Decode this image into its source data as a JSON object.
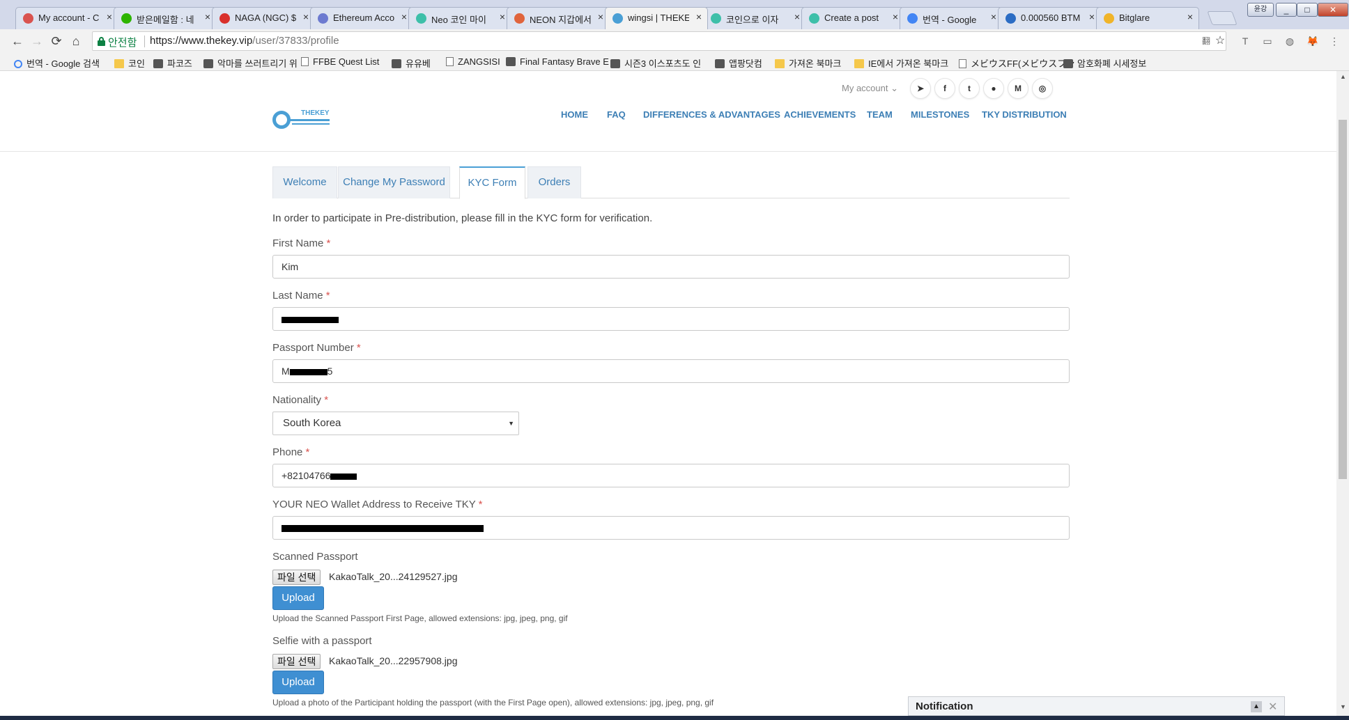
{
  "browser": {
    "tabs": [
      {
        "label": "My account - C",
        "color": "#d9534f"
      },
      {
        "label": "받은메일함 : 네",
        "color": "#2db400"
      },
      {
        "label": "NAGA (NGC) $",
        "color": "#d9302c"
      },
      {
        "label": "Ethereum Acco",
        "color": "#6c7ad0"
      },
      {
        "label": "Neo 코인 마이",
        "color": "#3dbfa9"
      },
      {
        "label": "NEON 지갑에서",
        "color": "#e0643c"
      },
      {
        "label": "wingsi | THEKE",
        "color": "#4a9fd5",
        "active": true
      },
      {
        "label": "코인으로 이자",
        "color": "#3dbfa9"
      },
      {
        "label": "Create a post",
        "color": "#3dbfa9"
      },
      {
        "label": "번역 - Google",
        "color": "#4285f4"
      },
      {
        "label": "0.000560 BTM",
        "color": "#2b6cc4"
      },
      {
        "label": "Bitglare",
        "color": "#f0b429"
      }
    ],
    "close_glyph": "×",
    "window_controls": {
      "user": "윤강",
      "minimize": "_",
      "restore": "□",
      "close": "✕"
    },
    "nav": {
      "back": "←",
      "forward": "→",
      "reload": "⟳",
      "home": "⌂"
    },
    "secure_label": "안전함",
    "url_host": "https://www.thekey.vip",
    "url_path": "/user/37833/profile",
    "toolbar_icons": {
      "translate": "翻",
      "star": "☆",
      "ext1": "T",
      "ext2": "▭",
      "ext3": "◍",
      "fox": "🦊",
      "menu": "⋮"
    },
    "bookmarks": [
      {
        "label": "번역 - Google 검색",
        "icon": "google-icon"
      },
      {
        "label": "코인",
        "icon": "folder-icon"
      },
      {
        "label": "파코즈",
        "icon": "site-icon"
      },
      {
        "label": "악마를 쓰러트리기 위",
        "icon": "site-icon"
      },
      {
        "label": "FFBE Quest List",
        "icon": "page-icon"
      },
      {
        "label": "유유베",
        "icon": "site-icon"
      },
      {
        "label": "ZANGSISI",
        "icon": "page-icon"
      },
      {
        "label": "Final Fantasy Brave E",
        "icon": "site-icon"
      },
      {
        "label": "시즌3 이스포츠도 인",
        "icon": "site-icon"
      },
      {
        "label": "앱팡닷컴",
        "icon": "site-icon"
      },
      {
        "label": "가져온 북마크",
        "icon": "folder-icon"
      },
      {
        "label": "IE에서 가져온 북마크",
        "icon": "folder-icon"
      },
      {
        "label": "メビウスFF(メビウスファ",
        "icon": "page-icon"
      },
      {
        "label": "암호화폐 시세정보",
        "icon": "site-icon"
      }
    ],
    "scroll": {
      "up": "▲",
      "down": "▼"
    }
  },
  "site": {
    "logo_text": "THEKEY",
    "account_link": "My account ⌄",
    "social_icons": [
      {
        "name": "telegram-icon",
        "glyph": "➤"
      },
      {
        "name": "facebook-icon",
        "glyph": "f"
      },
      {
        "name": "twitter-icon",
        "glyph": "t"
      },
      {
        "name": "reddit-icon",
        "glyph": "●"
      },
      {
        "name": "medium-icon",
        "glyph": "M"
      },
      {
        "name": "github-icon",
        "glyph": "◎"
      }
    ],
    "nav": [
      "HOME",
      "FAQ",
      "DIFFERENCES & ADVANTAGES",
      "ACHIEVEMENTS",
      "TEAM",
      "MILESTONES",
      "TKY DISTRIBUTION"
    ],
    "accent": "#3d7fb5"
  },
  "profile_tabs": [
    {
      "label": "Welcome"
    },
    {
      "label": "Change My Password"
    },
    {
      "label": "KYC Form",
      "active": true
    },
    {
      "label": "Orders"
    }
  ],
  "kyc": {
    "intro": "In order to participate in Pre-distribution, please fill in the KYC form for verification.",
    "required_mark": "*",
    "first_name": {
      "label": "First Name",
      "value": "Kim"
    },
    "last_name": {
      "label": "Last Name",
      "value": ""
    },
    "passport_number": {
      "label": "Passport Number",
      "value_prefix": "M",
      "value_suffix": "5"
    },
    "nationality": {
      "label": "Nationality",
      "selected": "South Korea",
      "caret": "▼"
    },
    "phone": {
      "label": "Phone",
      "value_prefix": "+82104766"
    },
    "wallet": {
      "label": "YOUR NEO Wallet Address to Receive TKY"
    },
    "scanned_passport": {
      "label": "Scanned Passport",
      "choose_file": "파일 선택",
      "filename": "KakaoTalk_20...24129527.jpg",
      "upload": "Upload",
      "help": "Upload the Scanned Passport First Page, allowed extensions: jpg, jpeg, png, gif"
    },
    "selfie": {
      "label": "Selfie with a passport",
      "choose_file": "파일 선택",
      "filename": "KakaoTalk_20...22957908.jpg",
      "upload": "Upload",
      "help": "Upload a photo of the Participant holding the passport (with the First Page open), allowed extensions: jpg, jpeg, png, gif"
    }
  },
  "notification": {
    "title": "Notification",
    "up": "▲",
    "close": "✕"
  }
}
